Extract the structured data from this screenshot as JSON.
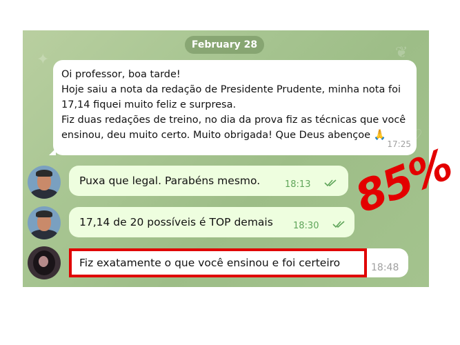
{
  "chat": {
    "date_separator": "February 28",
    "incoming_message": {
      "lines": [
        "Oi professor, boa tarde!",
        "Hoje saiu a nota da redação de Presidente Prudente, minha nota foi",
        "17,14 fiquei muito feliz e surpresa.",
        "Fiz duas redações de treino, no dia da prova fiz as técnicas que você",
        "ensinou, deu muito certo. Muito obrigada! Que Deus abençoe 🙏"
      ],
      "time": "17:25"
    },
    "replies": [
      {
        "text": "Puxa que legal. Parabéns mesmo.",
        "time": "18:13",
        "status": "read-double-check"
      },
      {
        "text": "17,14 de 20 possíveis é TOP demais",
        "time": "18:30",
        "status": "read-double-check"
      },
      {
        "text": "Fiz exatamente o que você ensinou e foi certeiro",
        "time": "18:48"
      }
    ]
  },
  "overlay": {
    "percent_text": "85%",
    "accent_color": "#e30000"
  }
}
